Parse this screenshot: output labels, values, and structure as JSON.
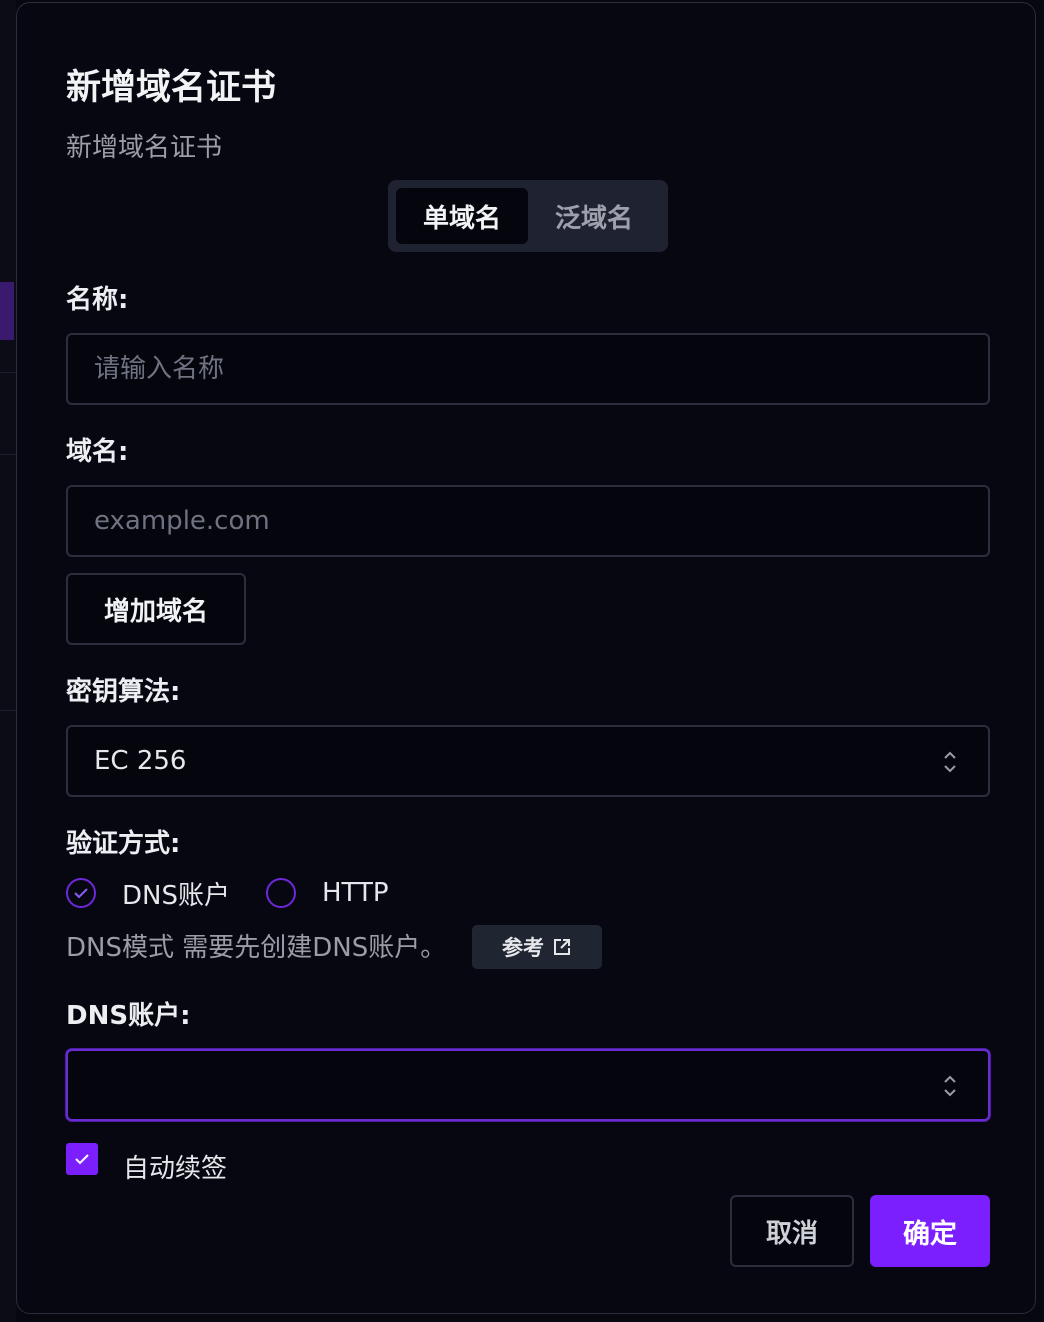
{
  "dialog": {
    "title": "新增域名证书",
    "subtitle": "新增域名证书"
  },
  "tabs": [
    {
      "label": "单域名",
      "active": true
    },
    {
      "label": "泛域名",
      "active": false
    }
  ],
  "form": {
    "name": {
      "label": "名称:",
      "placeholder": "请输入名称",
      "value": ""
    },
    "domain": {
      "label": "域名:",
      "placeholder": "example.com",
      "value": "",
      "add_button": "增加域名"
    },
    "key_algorithm": {
      "label": "密钥算法:",
      "selected": "EC 256"
    },
    "verification": {
      "label": "验证方式:",
      "options": [
        {
          "label": "DNS账户",
          "selected": true
        },
        {
          "label": "HTTP",
          "selected": false
        }
      ],
      "hint": "DNS模式 需要先创建DNS账户。",
      "reference_button": "参考"
    },
    "dns_account": {
      "label": "DNS账户:",
      "selected": ""
    },
    "auto_renew": {
      "label": "自动续签",
      "checked": true
    }
  },
  "actions": {
    "cancel": "取消",
    "confirm": "确定"
  },
  "colors": {
    "accent": "#7c1fff",
    "background": "#060711",
    "border": "#2b2e3b"
  }
}
